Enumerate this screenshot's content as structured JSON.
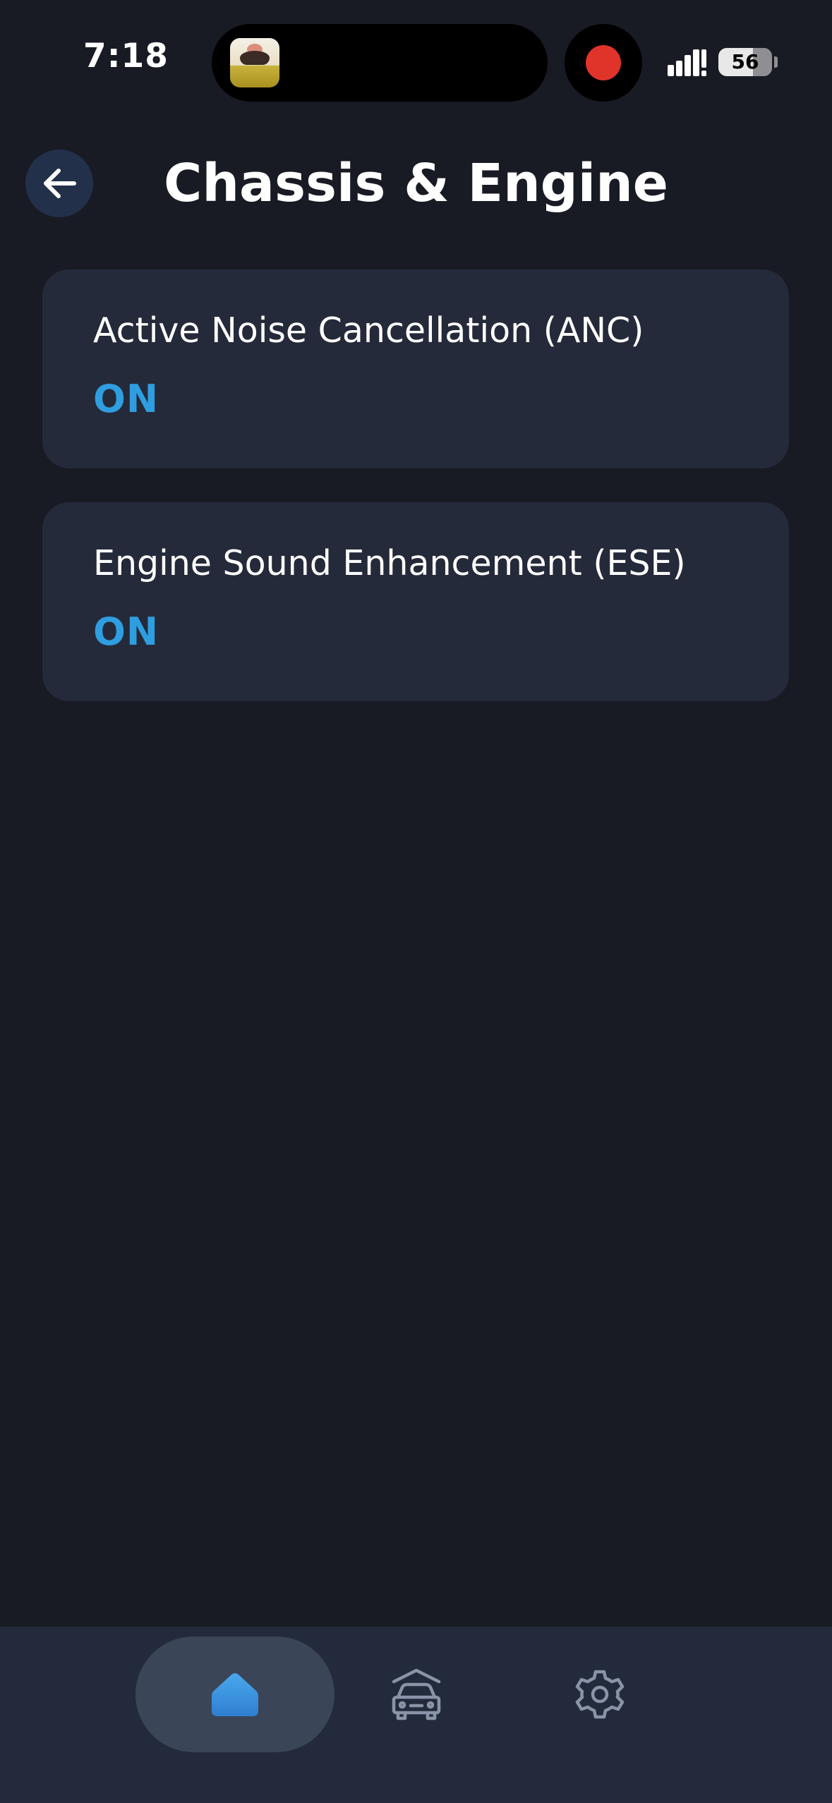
{
  "status_bar": {
    "time": "7:18",
    "battery_percent": "56",
    "recording_indicator_color": "#e0342a",
    "signal_icon": "signal-bars-icon"
  },
  "header": {
    "title": "Chassis & Engine",
    "back_icon": "arrow-left-icon"
  },
  "settings": [
    {
      "label": "Active Noise Cancellation (ANC)",
      "value": "ON"
    },
    {
      "label": "Engine Sound Enhancement (ESE)",
      "value": "ON"
    }
  ],
  "bottom_nav": {
    "items": [
      {
        "icon": "home-icon",
        "active": true
      },
      {
        "icon": "car-icon",
        "active": false
      },
      {
        "icon": "gear-icon",
        "active": false
      }
    ]
  },
  "colors": {
    "background": "#181b24",
    "card": "#252a3a",
    "accent": "#2f9ee0",
    "nav_bar": "#232a3b",
    "nav_active_pill": "#3a4558",
    "icon_inactive": "#8a94a8"
  }
}
